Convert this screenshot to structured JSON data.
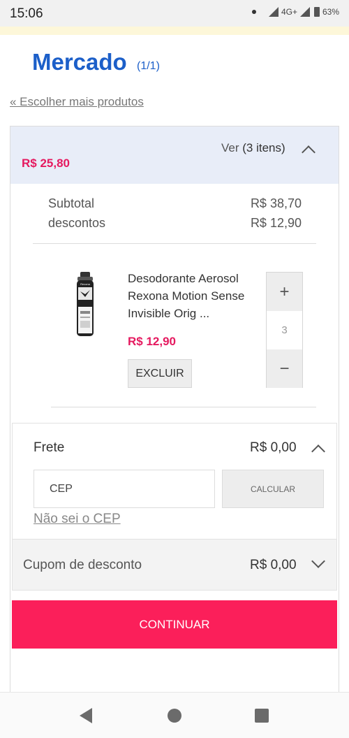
{
  "status_bar": {
    "time": "15:06",
    "network": "4G+",
    "battery": "63%"
  },
  "header": {
    "title": "Mercado",
    "page_count": "(1/1)",
    "back_link": "« Escolher mais produtos"
  },
  "cart": {
    "view_prefix": "Ver",
    "view_count": "(3 itens)",
    "total": "R$ 25,80",
    "subtotal_label": "Subtotal",
    "subtotal_value": "R$ 38,70",
    "discount_label": "descontos",
    "discount_value": "R$ 12,90"
  },
  "product": {
    "name": "Desodorante Aerosol Rexona Motion Sense Invisible Orig ...",
    "price": "R$ 12,90",
    "remove_label": "EXCLUIR",
    "quantity": "3",
    "increment_label": "+",
    "decrement_label": "−",
    "image_text": "Rexona"
  },
  "shipping": {
    "label": "Frete",
    "value": "R$ 0,00",
    "cep_placeholder": "CEP",
    "calculate_label": "CALCULAR",
    "unknown_cep_link": "Não sei o CEP"
  },
  "coupon": {
    "label": "Cupom de desconto",
    "value": "R$ 0,00"
  },
  "actions": {
    "continue_label": "CONTINUAR"
  },
  "colors": {
    "brand_blue": "#1c5fc9",
    "price_pink": "#e5195f",
    "cta_pink": "#fb1f5a"
  },
  "icons": {
    "expand": "chevron-up-icon",
    "collapse": "chevron-down-icon",
    "nav_back": "triangle-back-icon",
    "nav_home": "circle-home-icon",
    "nav_recent": "square-recent-icon"
  }
}
